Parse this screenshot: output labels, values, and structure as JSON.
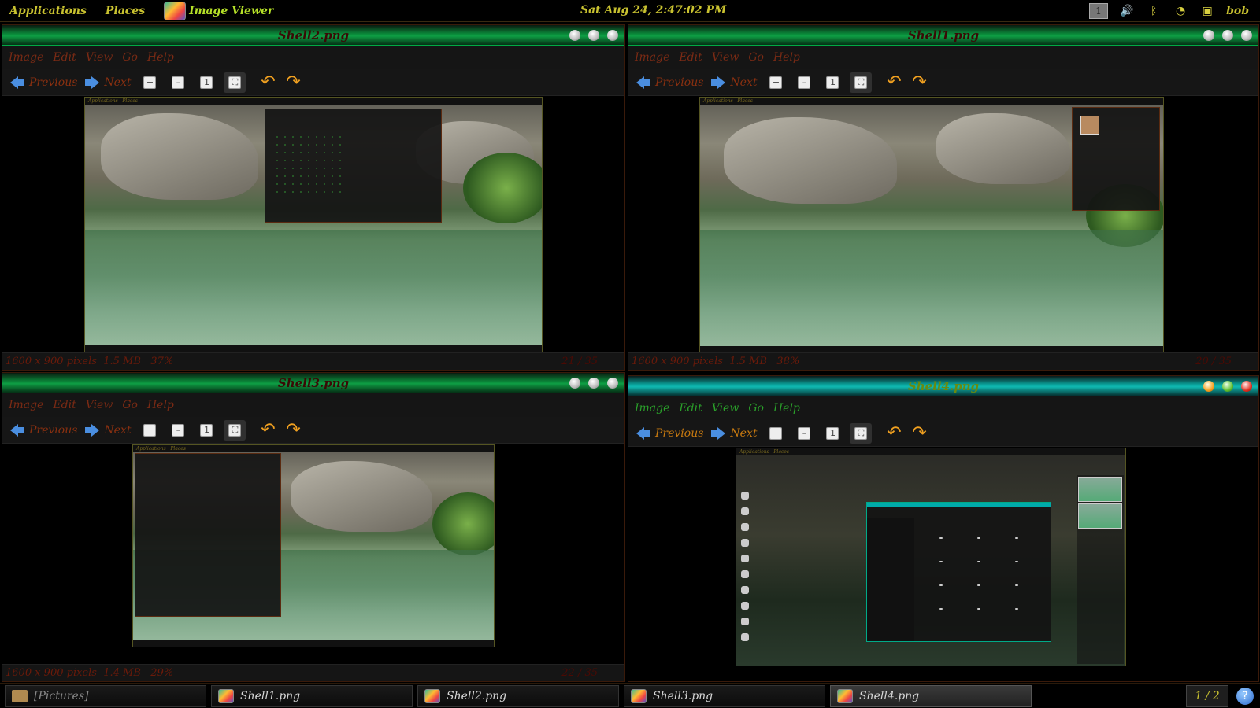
{
  "top_panel": {
    "applications": "Applications",
    "places": "Places",
    "app_name": "Image Viewer",
    "clock": "Sat Aug 24,  2:47:02 PM",
    "workspace": "1",
    "user": "bob"
  },
  "windows": [
    {
      "title": "Shell2.png",
      "status": "1600 x 900 pixels  1.5 MB   37%",
      "pager": "21 / 35"
    },
    {
      "title": "Shell1.png",
      "status": "1600 x 900 pixels  1.5 MB   38%",
      "pager": "20 / 35"
    },
    {
      "title": "Shell3.png",
      "status": "1600 x 900 pixels  1.4 MB   29%",
      "pager": "22 / 35"
    },
    {
      "title": "Shell4.png",
      "status": "",
      "pager": ""
    }
  ],
  "menu": {
    "image": "Image",
    "edit": "Edit",
    "view": "View",
    "go": "Go",
    "help": "Help"
  },
  "toolbar": {
    "previous": "Previous",
    "next": "Next"
  },
  "taskbar": {
    "items": [
      "[Pictures]",
      "Shell1.png",
      "Shell2.png",
      "Shell3.png",
      "Shell4.png"
    ],
    "pager": "1 / 2"
  },
  "colors": {
    "accent_active": "#10b8b0",
    "title_inactive": "#0e9e44",
    "menu_active": "#2aa02a",
    "menu_inactive": "#7a2a14"
  }
}
